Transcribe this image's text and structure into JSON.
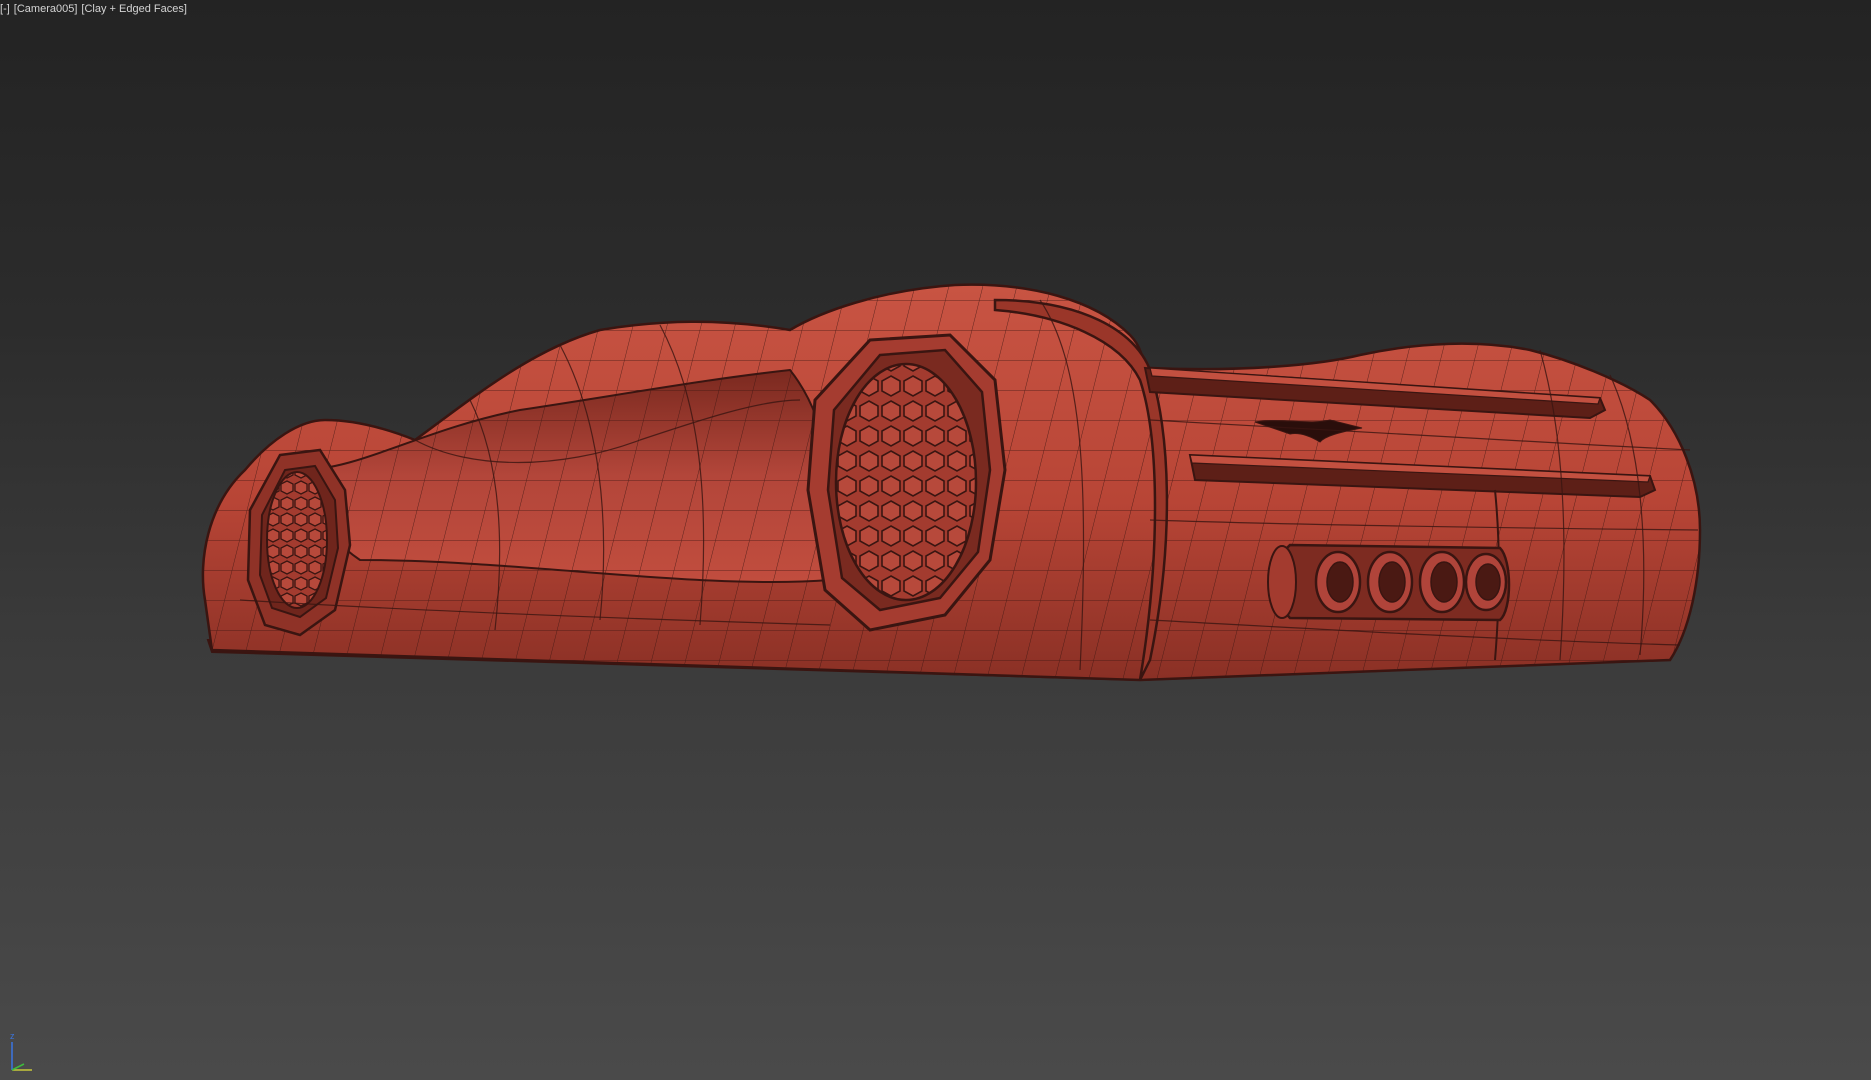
{
  "viewport": {
    "menu_label": "-",
    "camera_label": "Camera005",
    "shading_label": "Clay + Edged Faces",
    "background_top": "#232323",
    "background_bottom": "#4a4a4a"
  },
  "model": {
    "body_color": "#b84536",
    "body_highlight": "#c85443",
    "body_shadow": "#7e2a20",
    "edge_color": "#3a1511"
  },
  "axis_gizmo": {
    "z_label": "z",
    "z_color": "#3b73d9",
    "x_color": "#c8c83a",
    "y_color": "#3dbb3d"
  }
}
